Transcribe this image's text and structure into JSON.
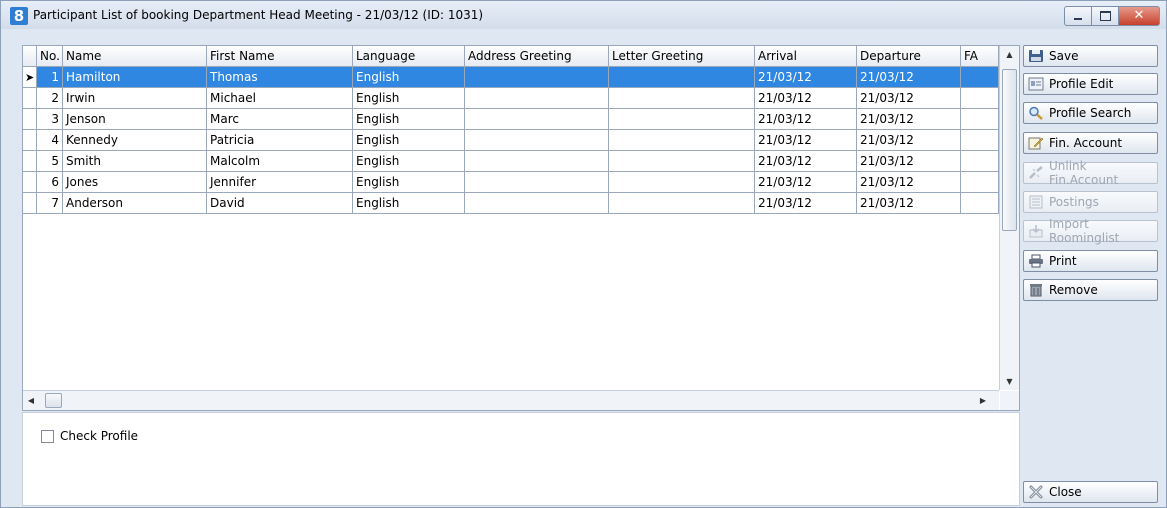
{
  "window": {
    "title": "Participant List of booking Department Head Meeting - 21/03/12 (ID: 1031)",
    "app_icon_text": "8",
    "close_glyph": "✕"
  },
  "grid": {
    "columns": [
      "No.",
      "Name",
      "First Name",
      "Language",
      "Address Greeting",
      "Letter Greeting",
      "Arrival",
      "Departure",
      "FA"
    ],
    "rows": [
      {
        "no": "1",
        "name": "Hamilton",
        "first": "Thomas",
        "lang": "English",
        "addr": "",
        "letter": "",
        "arrival": "21/03/12",
        "departure": "21/03/12",
        "fa": "",
        "selected": true
      },
      {
        "no": "2",
        "name": "Irwin",
        "first": "Michael",
        "lang": "English",
        "addr": "",
        "letter": "",
        "arrival": "21/03/12",
        "departure": "21/03/12",
        "fa": ""
      },
      {
        "no": "3",
        "name": "Jenson",
        "first": "Marc",
        "lang": "English",
        "addr": "",
        "letter": "",
        "arrival": "21/03/12",
        "departure": "21/03/12",
        "fa": ""
      },
      {
        "no": "4",
        "name": "Kennedy",
        "first": "Patricia",
        "lang": "English",
        "addr": "",
        "letter": "",
        "arrival": "21/03/12",
        "departure": "21/03/12",
        "fa": ""
      },
      {
        "no": "5",
        "name": "Smith",
        "first": "Malcolm",
        "lang": "English",
        "addr": "",
        "letter": "",
        "arrival": "21/03/12",
        "departure": "21/03/12",
        "fa": ""
      },
      {
        "no": "6",
        "name": "Jones",
        "first": "Jennifer",
        "lang": "English",
        "addr": "",
        "letter": "",
        "arrival": "21/03/12",
        "departure": "21/03/12",
        "fa": ""
      },
      {
        "no": "7",
        "name": "Anderson",
        "first": "David",
        "lang": "English",
        "addr": "",
        "letter": "",
        "arrival": "21/03/12",
        "departure": "21/03/12",
        "fa": ""
      }
    ],
    "row_indicator": "➤",
    "scroll_up": "▲",
    "scroll_down": "▼",
    "scroll_left": "◀",
    "scroll_right": "▶"
  },
  "options": {
    "check_profile_label": "Check Profile",
    "check_profile_checked": false
  },
  "sidebar": {
    "buttons": [
      {
        "label": "Save",
        "icon": "save-icon",
        "enabled": true
      },
      {
        "label": "Profile Edit",
        "icon": "profile-edit-icon",
        "enabled": true
      },
      {
        "label": "Profile Search",
        "icon": "search-icon",
        "enabled": true
      },
      {
        "label": "Fin. Account",
        "icon": "fin-account-icon",
        "enabled": true
      },
      {
        "label": "Unlink Fin.Account",
        "icon": "unlink-icon",
        "enabled": false
      },
      {
        "label": "Postings",
        "icon": "postings-icon",
        "enabled": false
      },
      {
        "label": "Import Roominglist",
        "icon": "import-icon",
        "enabled": false
      },
      {
        "label": "Print",
        "icon": "print-icon",
        "enabled": true
      },
      {
        "label": "Remove",
        "icon": "trash-icon",
        "enabled": true
      }
    ],
    "close_label": "Close"
  },
  "colors": {
    "selection": "#2f87e1",
    "title_gradient_top": "#e7eef8",
    "close_button": "#c7412c"
  }
}
